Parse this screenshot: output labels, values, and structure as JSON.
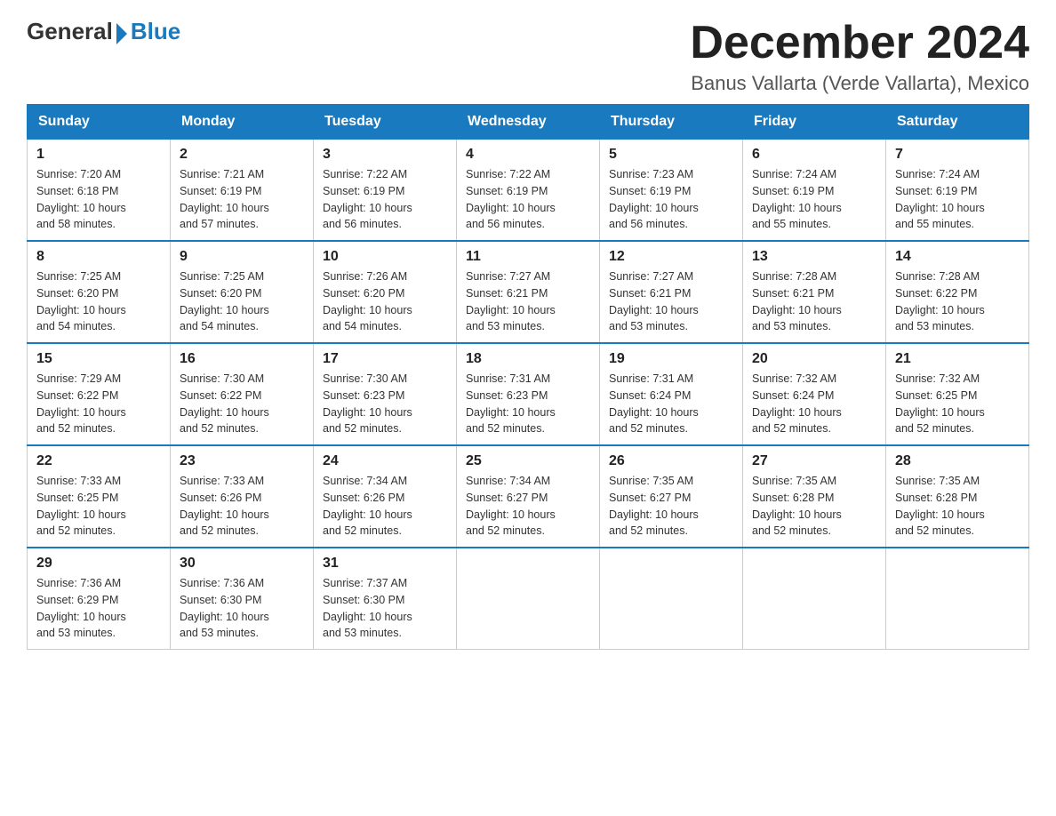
{
  "header": {
    "logo_general": "General",
    "logo_blue": "Blue",
    "month_title": "December 2024",
    "location": "Banus Vallarta (Verde Vallarta), Mexico"
  },
  "days_of_week": [
    "Sunday",
    "Monday",
    "Tuesday",
    "Wednesday",
    "Thursday",
    "Friday",
    "Saturday"
  ],
  "weeks": [
    [
      {
        "day": "1",
        "sunrise": "7:20 AM",
        "sunset": "6:18 PM",
        "daylight": "10 hours and 58 minutes."
      },
      {
        "day": "2",
        "sunrise": "7:21 AM",
        "sunset": "6:19 PM",
        "daylight": "10 hours and 57 minutes."
      },
      {
        "day": "3",
        "sunrise": "7:22 AM",
        "sunset": "6:19 PM",
        "daylight": "10 hours and 56 minutes."
      },
      {
        "day": "4",
        "sunrise": "7:22 AM",
        "sunset": "6:19 PM",
        "daylight": "10 hours and 56 minutes."
      },
      {
        "day": "5",
        "sunrise": "7:23 AM",
        "sunset": "6:19 PM",
        "daylight": "10 hours and 56 minutes."
      },
      {
        "day": "6",
        "sunrise": "7:24 AM",
        "sunset": "6:19 PM",
        "daylight": "10 hours and 55 minutes."
      },
      {
        "day": "7",
        "sunrise": "7:24 AM",
        "sunset": "6:19 PM",
        "daylight": "10 hours and 55 minutes."
      }
    ],
    [
      {
        "day": "8",
        "sunrise": "7:25 AM",
        "sunset": "6:20 PM",
        "daylight": "10 hours and 54 minutes."
      },
      {
        "day": "9",
        "sunrise": "7:25 AM",
        "sunset": "6:20 PM",
        "daylight": "10 hours and 54 minutes."
      },
      {
        "day": "10",
        "sunrise": "7:26 AM",
        "sunset": "6:20 PM",
        "daylight": "10 hours and 54 minutes."
      },
      {
        "day": "11",
        "sunrise": "7:27 AM",
        "sunset": "6:21 PM",
        "daylight": "10 hours and 53 minutes."
      },
      {
        "day": "12",
        "sunrise": "7:27 AM",
        "sunset": "6:21 PM",
        "daylight": "10 hours and 53 minutes."
      },
      {
        "day": "13",
        "sunrise": "7:28 AM",
        "sunset": "6:21 PM",
        "daylight": "10 hours and 53 minutes."
      },
      {
        "day": "14",
        "sunrise": "7:28 AM",
        "sunset": "6:22 PM",
        "daylight": "10 hours and 53 minutes."
      }
    ],
    [
      {
        "day": "15",
        "sunrise": "7:29 AM",
        "sunset": "6:22 PM",
        "daylight": "10 hours and 52 minutes."
      },
      {
        "day": "16",
        "sunrise": "7:30 AM",
        "sunset": "6:22 PM",
        "daylight": "10 hours and 52 minutes."
      },
      {
        "day": "17",
        "sunrise": "7:30 AM",
        "sunset": "6:23 PM",
        "daylight": "10 hours and 52 minutes."
      },
      {
        "day": "18",
        "sunrise": "7:31 AM",
        "sunset": "6:23 PM",
        "daylight": "10 hours and 52 minutes."
      },
      {
        "day": "19",
        "sunrise": "7:31 AM",
        "sunset": "6:24 PM",
        "daylight": "10 hours and 52 minutes."
      },
      {
        "day": "20",
        "sunrise": "7:32 AM",
        "sunset": "6:24 PM",
        "daylight": "10 hours and 52 minutes."
      },
      {
        "day": "21",
        "sunrise": "7:32 AM",
        "sunset": "6:25 PM",
        "daylight": "10 hours and 52 minutes."
      }
    ],
    [
      {
        "day": "22",
        "sunrise": "7:33 AM",
        "sunset": "6:25 PM",
        "daylight": "10 hours and 52 minutes."
      },
      {
        "day": "23",
        "sunrise": "7:33 AM",
        "sunset": "6:26 PM",
        "daylight": "10 hours and 52 minutes."
      },
      {
        "day": "24",
        "sunrise": "7:34 AM",
        "sunset": "6:26 PM",
        "daylight": "10 hours and 52 minutes."
      },
      {
        "day": "25",
        "sunrise": "7:34 AM",
        "sunset": "6:27 PM",
        "daylight": "10 hours and 52 minutes."
      },
      {
        "day": "26",
        "sunrise": "7:35 AM",
        "sunset": "6:27 PM",
        "daylight": "10 hours and 52 minutes."
      },
      {
        "day": "27",
        "sunrise": "7:35 AM",
        "sunset": "6:28 PM",
        "daylight": "10 hours and 52 minutes."
      },
      {
        "day": "28",
        "sunrise": "7:35 AM",
        "sunset": "6:28 PM",
        "daylight": "10 hours and 52 minutes."
      }
    ],
    [
      {
        "day": "29",
        "sunrise": "7:36 AM",
        "sunset": "6:29 PM",
        "daylight": "10 hours and 53 minutes."
      },
      {
        "day": "30",
        "sunrise": "7:36 AM",
        "sunset": "6:30 PM",
        "daylight": "10 hours and 53 minutes."
      },
      {
        "day": "31",
        "sunrise": "7:37 AM",
        "sunset": "6:30 PM",
        "daylight": "10 hours and 53 minutes."
      },
      null,
      null,
      null,
      null
    ]
  ],
  "labels": {
    "sunrise": "Sunrise:",
    "sunset": "Sunset:",
    "daylight": "Daylight:"
  }
}
